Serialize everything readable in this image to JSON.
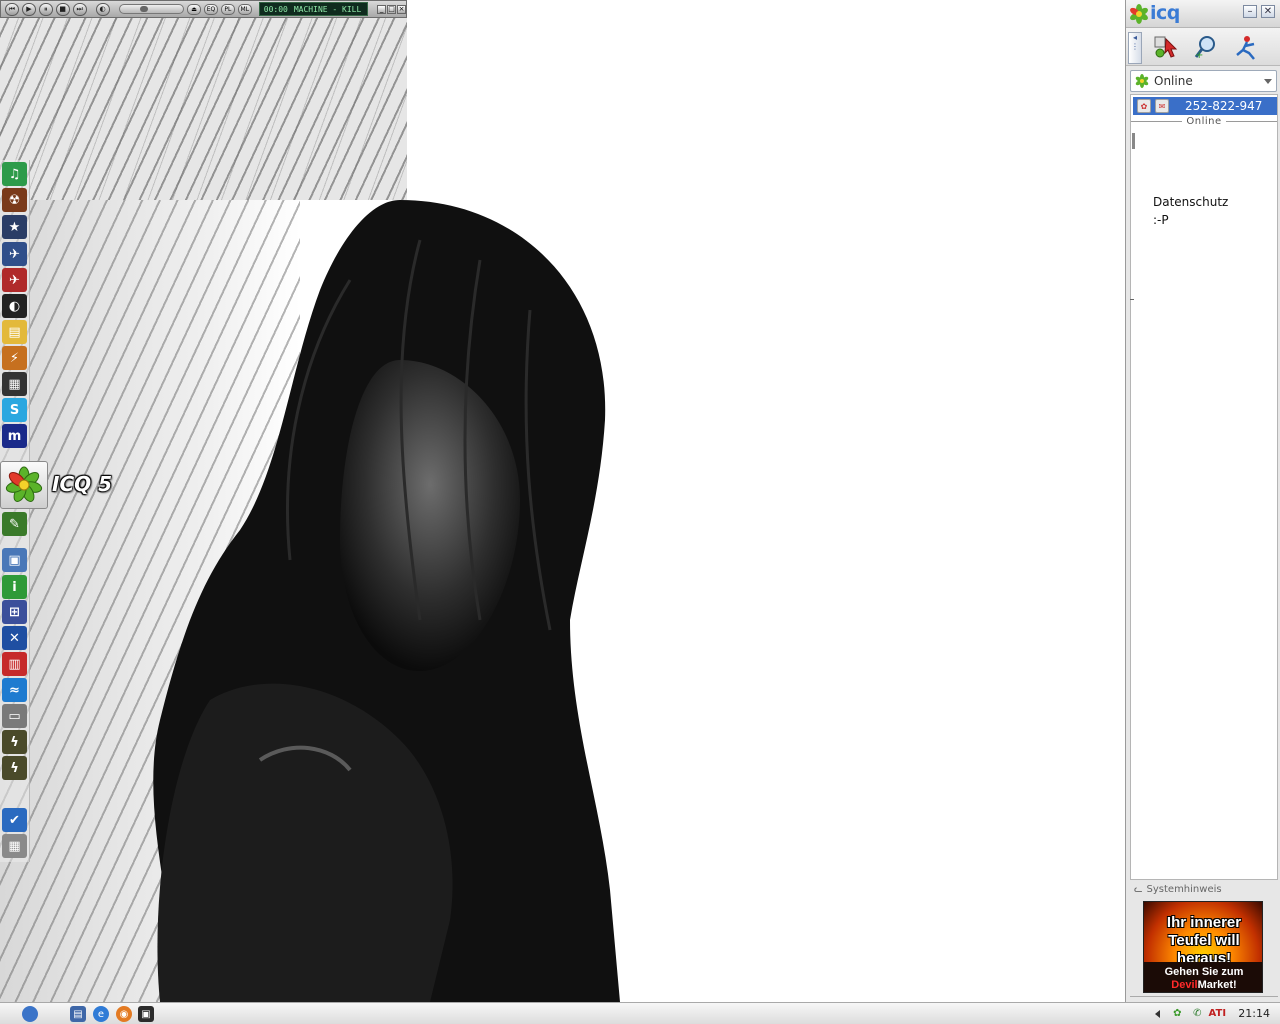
{
  "winamp": {
    "time": "00:00",
    "track": "MACHINE - KILL",
    "buttons": [
      "prev",
      "play",
      "pause",
      "stop",
      "next"
    ],
    "mini_labels": [
      "EQ",
      "PL",
      "ML"
    ],
    "window_buttons": [
      "_",
      "□",
      "×"
    ]
  },
  "dock": {
    "active_label": "ICQ 5",
    "items": [
      {
        "name": "itunes-icon",
        "glyph": "♫",
        "color": "#2d9b4a"
      },
      {
        "name": "scorched-icon",
        "glyph": "☢",
        "color": "#7a3a1a"
      },
      {
        "name": "star-game-icon",
        "glyph": "★",
        "color": "#2a3d66"
      },
      {
        "name": "flight-sim-icon",
        "glyph": "✈",
        "color": "#304f8a"
      },
      {
        "name": "airline-icon",
        "glyph": "✈",
        "color": "#b02a2a"
      },
      {
        "name": "steam-icon",
        "glyph": "◐",
        "color": "#222222"
      },
      {
        "name": "folder-icon",
        "glyph": "▤",
        "color": "#e3b93a"
      },
      {
        "name": "filezilla-icon",
        "glyph": "⚡",
        "color": "#c6701f"
      },
      {
        "name": "movie-icon",
        "glyph": "▦",
        "color": "#333333"
      },
      {
        "name": "skype-icon",
        "glyph": "S",
        "color": "#2aa7e0"
      },
      {
        "name": "mirc-icon",
        "glyph": "m",
        "color": "#1a2a8a"
      },
      {
        "name": "quill-icon",
        "glyph": "✎",
        "color": "#3a7a2a"
      },
      {
        "name": "photo-icon",
        "glyph": "▣",
        "color": "#4a78b8"
      },
      {
        "name": "info-icon",
        "glyph": "i",
        "color": "#2f9a38"
      },
      {
        "name": "one-and-one-icon",
        "glyph": "⊞",
        "color": "#3b4f9b"
      },
      {
        "name": "xfire-icon",
        "glyph": "✕",
        "color": "#1f4fa2"
      },
      {
        "name": "tv-icon",
        "glyph": "▥",
        "color": "#c62a2a"
      },
      {
        "name": "audio-wave-icon",
        "glyph": "≈",
        "color": "#1e7bd0"
      },
      {
        "name": "drive-icon",
        "glyph": "▭",
        "color": "#7a7a7a"
      },
      {
        "name": "winamp-shortcut-1-icon",
        "glyph": "ϟ",
        "color": "#4a4a2a"
      },
      {
        "name": "winamp-shortcut-2-icon",
        "glyph": "ϟ",
        "color": "#4a4a2a"
      },
      {
        "name": "checklist-icon",
        "glyph": "✔",
        "color": "#2a6ac0"
      },
      {
        "name": "trash-icon",
        "glyph": "▦",
        "color": "#8a8a8a"
      }
    ]
  },
  "icq": {
    "title": "icq",
    "status": "Online",
    "contact_uin": "252-822-947",
    "group_label": "Online",
    "note_lines": [
      "Datenschutz",
      ":-P"
    ],
    "system_hint_label": "Systemhinweis",
    "ad": {
      "line1": "Ihr innerer Teufel will heraus!",
      "line2_prefix": "Gehen Sie zum",
      "line2_devil": "Devil",
      "line2_suffix": "Market!"
    },
    "colors": {
      "accent": "#3a6fc8",
      "logo": "#3a7bd5"
    }
  },
  "taskbar": {
    "clock": "21:14"
  }
}
